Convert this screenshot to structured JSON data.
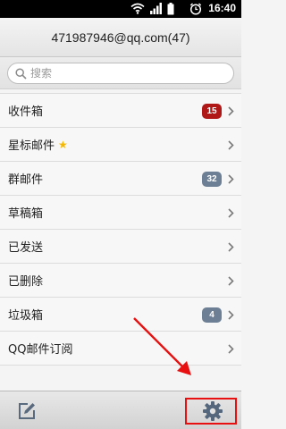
{
  "status_bar": {
    "time": "16:40"
  },
  "header": {
    "account_title": "471987946@qq.com(47)"
  },
  "search": {
    "placeholder": "搜索",
    "value": ""
  },
  "folders": [
    {
      "label": "收件箱",
      "badge": "15",
      "badge_color": "#b01818"
    },
    {
      "label": "星标邮件",
      "starred": true
    },
    {
      "label": "群邮件",
      "badge": "32",
      "badge_color": "#6d7f94"
    },
    {
      "label": "草稿箱"
    },
    {
      "label": "已发送"
    },
    {
      "label": "已删除"
    },
    {
      "label": "垃圾箱",
      "badge": "4",
      "badge_color": "#6d7f94"
    },
    {
      "label": "QQ邮件订阅"
    }
  ],
  "toolbar": {
    "left_icon": "compose-icon",
    "right_icon": "gear-icon"
  },
  "annotation": {
    "highlight_color": "#e81010"
  }
}
